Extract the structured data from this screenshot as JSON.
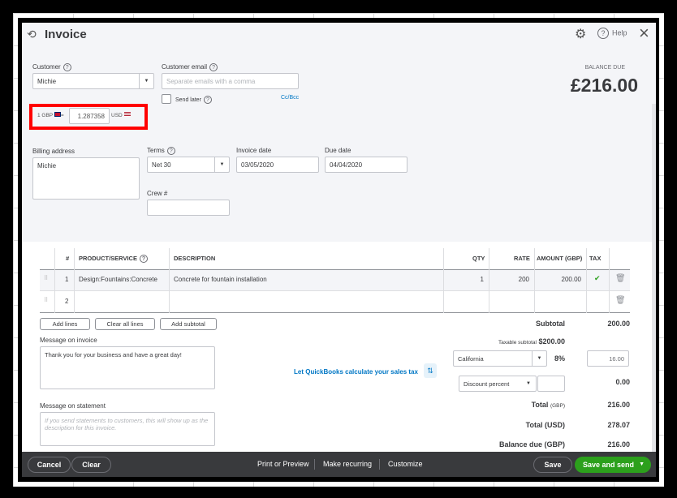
{
  "header": {
    "title": "Invoice",
    "help": "Help",
    "balance_due_label": "BALANCE DUE",
    "balance_due": "£216.00"
  },
  "customer": {
    "label": "Customer",
    "value": "Michie"
  },
  "email": {
    "label": "Customer email",
    "placeholder": "Separate emails with a comma",
    "send_later": "Send later",
    "cc_bcc": "Cc/Bcc"
  },
  "exchange": {
    "from": "1 GBP",
    "equals": "=",
    "rate": "1.287358",
    "to": "USD"
  },
  "billing": {
    "label": "Billing address",
    "value": "Michie"
  },
  "terms": {
    "label": "Terms",
    "value": "Net 30"
  },
  "invoice_date": {
    "label": "Invoice date",
    "value": "03/05/2020"
  },
  "due_date": {
    "label": "Due date",
    "value": "04/04/2020"
  },
  "crew": {
    "label": "Crew #",
    "value": ""
  },
  "table": {
    "headers": [
      "#",
      "PRODUCT/SERVICE",
      "DESCRIPTION",
      "QTY",
      "RATE",
      "AMOUNT (GBP)",
      "TAX"
    ],
    "rows": [
      {
        "num": "1",
        "product": "Design:Fountains:Concrete",
        "description": "Concrete for fountain installation",
        "qty": "1",
        "rate": "200",
        "amount": "200.00",
        "tax": "✔"
      },
      {
        "num": "2",
        "product": "",
        "description": "",
        "qty": "",
        "rate": "",
        "amount": "",
        "tax": ""
      }
    ]
  },
  "actions": {
    "add_lines": "Add lines",
    "clear_all": "Clear all lines",
    "add_subtotal": "Add subtotal"
  },
  "message_invoice": {
    "label": "Message on invoice",
    "value": "Thank you for your business and have a great day!"
  },
  "message_statement": {
    "label": "Message on statement",
    "placeholder": "If you send statements to customers, this will show up as the description for this invoice."
  },
  "tax_link": "Let QuickBooks calculate your sales tax",
  "totals": {
    "subtotal_label": "Subtotal",
    "subtotal": "200.00",
    "taxable_label": "Taxable subtotal",
    "taxable": "$200.00",
    "tax_region": "California",
    "tax_rate": "8%",
    "tax_amount": "16.00",
    "discount_type": "Discount percent",
    "discount_value": "",
    "discount_amount": "0.00",
    "total_label": "Total",
    "total_currency": "(GBP)",
    "total": "216.00",
    "total_usd_label": "Total (USD)",
    "total_usd": "278.07",
    "balance_label": "Balance due (GBP)",
    "balance": "216.00"
  },
  "footer": {
    "cancel": "Cancel",
    "clear": "Clear",
    "print": "Print or Preview",
    "recurring": "Make recurring",
    "customize": "Customize",
    "save": "Save",
    "save_send": "Save and send"
  },
  "colors": {
    "accent_green": "#2ca01c",
    "link_blue": "#0077c5",
    "highlight_red": "#ff0000"
  }
}
